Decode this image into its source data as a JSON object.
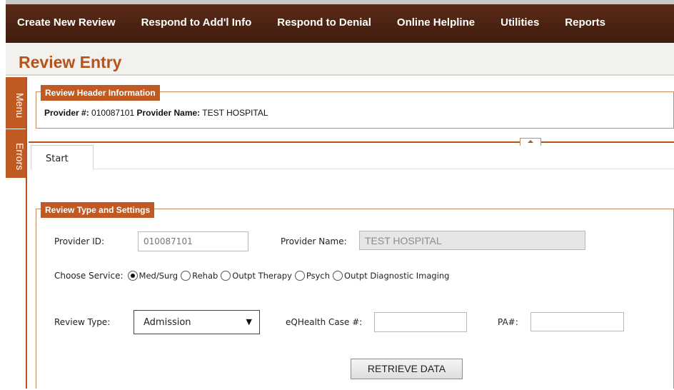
{
  "nav": {
    "items": [
      "Create New Review",
      "Respond to Add'l Info",
      "Respond to Denial",
      "Online Helpline",
      "Utilities",
      "Reports"
    ]
  },
  "page_title": "Review Entry",
  "side_tabs": {
    "menu": "Menu",
    "errors": "Errors"
  },
  "review_header": {
    "legend": "Review Header Information",
    "provider_num_label": "Provider #:",
    "provider_num": "010087101",
    "provider_name_label": "Provider Name:",
    "provider_name": "TEST HOSPITAL"
  },
  "tabs": {
    "start": "Start"
  },
  "review_settings": {
    "legend": "Review Type and Settings",
    "provider_id_label": "Provider ID:",
    "provider_id_placeholder": "010087101",
    "provider_name_label": "Provider Name:",
    "provider_name_value": "TEST HOSPITAL",
    "choose_service_label": "Choose Service:",
    "services": [
      {
        "label": "Med/Surg",
        "checked": true
      },
      {
        "label": "Rehab",
        "checked": false
      },
      {
        "label": "Outpt Therapy",
        "checked": false
      },
      {
        "label": "Psych",
        "checked": false
      },
      {
        "label": "Outpt Diagnostic Imaging",
        "checked": false
      }
    ],
    "review_type_label": "Review Type:",
    "review_type_value": "Admission",
    "eqhealth_label": "eQHealth Case #:",
    "eqhealth_value": "",
    "pa_label": "PA#:",
    "pa_value": "",
    "retrieve_button": "RETRIEVE DATA"
  },
  "colors": {
    "brand_dark": "#4a2212",
    "accent": "#c15a22",
    "title": "#b6521a"
  },
  "icons": {
    "dropdown": "triangle-down-icon",
    "collapse": "triangle-up-icon"
  }
}
